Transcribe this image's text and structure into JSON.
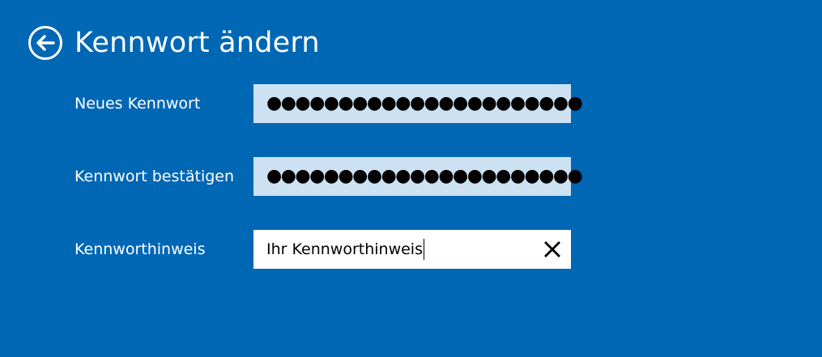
{
  "header": {
    "title": "Kennwort ändern",
    "back_icon": "arrow-left-circle-icon"
  },
  "form": {
    "new_password": {
      "label": "Neues Kennwort",
      "masked_value": "●●●●●●●●●●●●●●●●●●●●●●"
    },
    "confirm_password": {
      "label": "Kennwort bestätigen",
      "masked_value": "●●●●●●●●●●●●●●●●●●●●●●"
    },
    "hint": {
      "label": "Kennworthinweis",
      "value": "Ihr Kennworthinweis",
      "clear_icon": "close-icon"
    }
  },
  "colors": {
    "background": "#0067b5",
    "password_field": "#cce1f1",
    "text_field": "#ffffff",
    "text": "#ffffff"
  }
}
